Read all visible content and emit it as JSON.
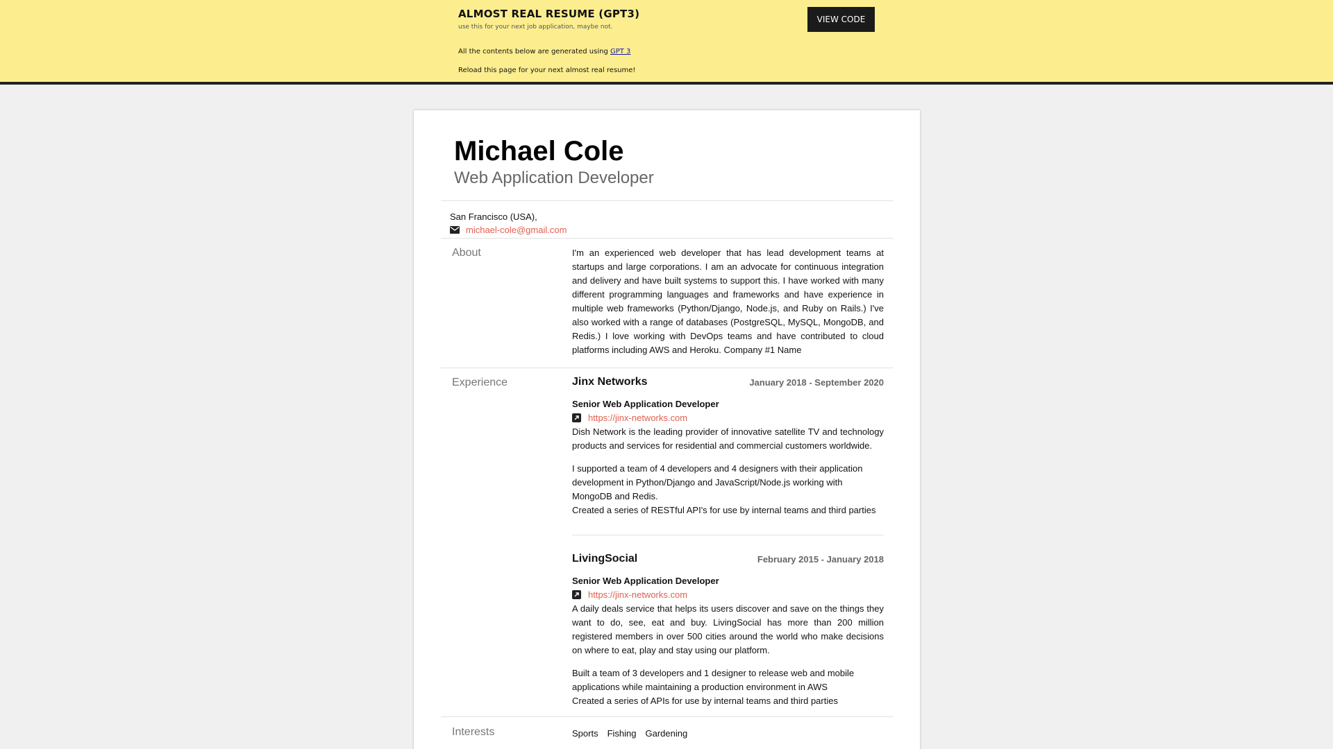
{
  "banner": {
    "title": "ALMOST REAL RESUME (GPT3)",
    "subtitle": "use this for your next job application, maybe not.",
    "line1_prefix": "All the contents below are generated using ",
    "line1_link": "GPT 3",
    "line2": "Reload this page for your next almost real resume!",
    "view_code_label": "VIEW CODE"
  },
  "resume": {
    "name": "Michael Cole",
    "role": "Web Application Developer",
    "location": "San Francisco (USA),",
    "email": "michael-cole@gmail.com",
    "about_label": "About",
    "about": "I'm an experienced web developer that has lead development teams at startups and large corporations. I am an advocate for continuous integration and delivery and have built systems to support this. I have worked with many different programming languages and frameworks and have experience in multiple web frameworks (Python/Django, Node.js, and Ruby on Rails.) I've also worked with a range of databases (PostgreSQL, MySQL, MongoDB, and Redis.) I love working with DevOps teams and have contributed to cloud platforms including AWS and Heroku. Company #1 Name",
    "experience_label": "Experience",
    "jobs": [
      {
        "company": "Jinx Networks",
        "dates": "January 2018 - September 2020",
        "title": "Senior Web Application Developer",
        "url": "https://jinx-networks.com",
        "description": "Dish Network is the leading provider of innovative satellite TV and technology products and services for residential and commercial customers worldwide.",
        "highlight1": "I supported a team of 4 developers and 4 designers with their application development in Python/Django and JavaScript/Node.js working with MongoDB and Redis.",
        "highlight2": "Created a series of RESTful API's for use by internal teams and third parties"
      },
      {
        "company": "LivingSocial",
        "dates": "February 2015 - January 2018",
        "title": "Senior Web Application Developer",
        "url": "https://jinx-networks.com",
        "description": "A daily deals service that helps its users discover and save on the things they want to do, see, eat and buy. LivingSocial has more than 200 million registered members in over 500 cities around the world who make decisions on where to eat, play and stay using our platform.",
        "highlight1": "Built a team of 3 developers and 1 designer to release web and mobile applications while maintaining a production environment in AWS",
        "highlight2": "Created a series of APIs for use by internal teams and third parties"
      }
    ],
    "interests_label": "Interests",
    "interests": [
      "Sports",
      "Fishing",
      "Gardening"
    ]
  },
  "icons": {
    "email": "envelope-icon",
    "link": "external-link-icon"
  },
  "colors": {
    "banner_bg": "#fcee8e",
    "link": "#e0604f",
    "button_bg": "#1b1b1b"
  }
}
